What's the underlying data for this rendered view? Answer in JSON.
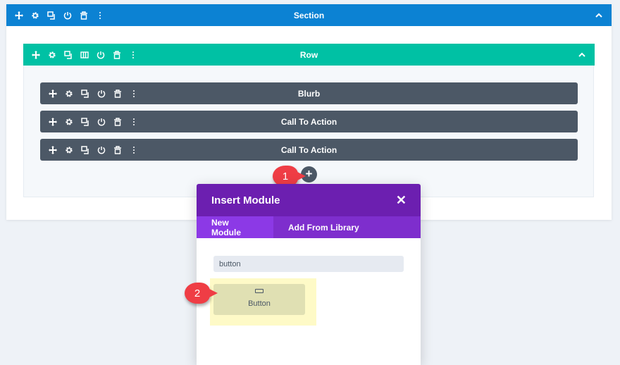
{
  "section": {
    "title": "Section"
  },
  "row": {
    "title": "Row"
  },
  "modules": [
    {
      "title": "Blurb"
    },
    {
      "title": "Call To Action"
    },
    {
      "title": "Call To Action"
    }
  ],
  "add_module": {
    "label": "+"
  },
  "modal": {
    "title": "Insert Module",
    "close": "✕",
    "tabs": [
      {
        "label": "New Module",
        "active": true
      },
      {
        "label": "Add From Library",
        "active": false
      }
    ],
    "search_value": "button",
    "results": [
      {
        "label": "Button"
      }
    ]
  },
  "callouts": [
    "1",
    "2"
  ],
  "colors": {
    "section": "#0c82d3",
    "row": "#00c1a4",
    "module": "#4c5866",
    "modal": "#6c1fb0",
    "callout": "#ef3d45"
  }
}
